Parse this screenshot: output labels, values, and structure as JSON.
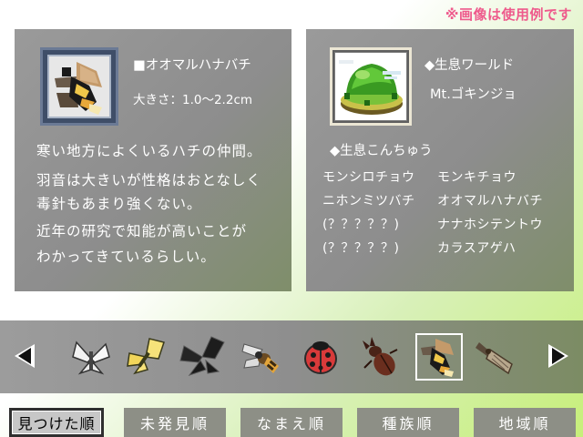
{
  "notice": "※画像は使用例です",
  "left_panel": {
    "name": "■オオマルハナバチ",
    "size": "大きさ：1.0〜2.2cm",
    "description": [
      "寒い地方によくいるハチの仲間。",
      "羽音は大きいが性格はおとなしく",
      "毒針もあまり強くない。",
      "近年の研究で知能が高いことが",
      "わかってきているらしい。"
    ],
    "portrait_icon": "bumblebee-icon"
  },
  "right_panel": {
    "world_heading": "◆生息ワールド",
    "world_name": "Mt.ゴキンジョ",
    "insects_heading": "◆生息こんちゅう",
    "insects": [
      [
        "モンシロチョウ",
        "モンキチョウ"
      ],
      [
        "ニホンミツバチ",
        "オオマルハナバチ"
      ],
      [
        "(？？？？？)",
        "ナナホシテントウ"
      ],
      [
        "(？？？？？)",
        "カラスアゲハ"
      ]
    ],
    "portrait_icon": "mountain-island-icon"
  },
  "carousel": {
    "items": [
      {
        "icon": "cabbage-white-butterfly-icon"
      },
      {
        "icon": "yellow-butterfly-icon"
      },
      {
        "icon": "swallowtail-butterfly-icon"
      },
      {
        "icon": "honeybee-icon"
      },
      {
        "icon": "ladybug-icon"
      },
      {
        "icon": "stag-beetle-icon"
      },
      {
        "icon": "bumblebee-icon"
      },
      {
        "icon": "cicada-icon"
      }
    ],
    "selected_index": 6
  },
  "sort_buttons": [
    {
      "label": "見つけた順",
      "active": true
    },
    {
      "label": "未発見順",
      "active": false
    },
    {
      "label": "なまえ順",
      "active": false
    },
    {
      "label": "種族順",
      "active": false
    },
    {
      "label": "地域順",
      "active": false
    }
  ]
}
